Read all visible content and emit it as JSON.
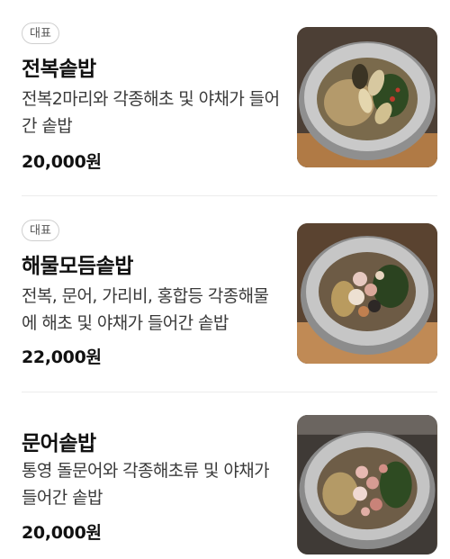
{
  "menu": {
    "items": [
      {
        "badge": "대표",
        "name": "전복솥밥",
        "description": "전복2마리와 각종해초 및 야채가 들어간 솥밥",
        "price": "20,000원",
        "image": "abalone-pot-rice-photo"
      },
      {
        "badge": "대표",
        "name": "해물모듬솥밥",
        "description": "전복, 문어, 가리비, 홍합등 각종해물에 해초 및 야채가 들어간 솥밥",
        "price": "22,000원",
        "image": "mixed-seafood-pot-rice-photo"
      },
      {
        "name": "문어솥밥",
        "description": "통영 돌문어와 각종해초류 및 야채가 들어간 솥밥",
        "price": "20,000원",
        "image": "octopus-pot-rice-photo"
      }
    ]
  }
}
